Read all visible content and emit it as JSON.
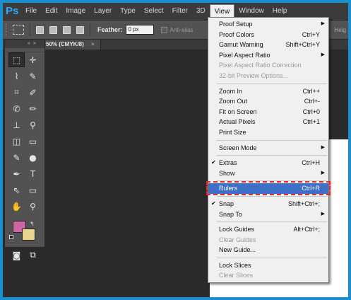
{
  "menubar": {
    "logo": "Ps",
    "items": [
      "File",
      "Edit",
      "Image",
      "Layer",
      "Type",
      "Select",
      "Filter",
      "3D",
      "View",
      "Window",
      "Help"
    ],
    "active": "View"
  },
  "options": {
    "feather_label": "Feather:",
    "feather_value": "0 px",
    "antialias_label": "Anti-alias",
    "height_label": "Heig"
  },
  "document": {
    "tab_label": "50% (CMYK/8)",
    "close_glyph": "×"
  },
  "tools_panel": {
    "header": "«  »",
    "tool_glyphs": [
      [
        "⬚",
        "✛"
      ],
      [
        "⌇",
        "✎"
      ],
      [
        "⌗",
        "✐"
      ],
      [
        "✆",
        "✏"
      ],
      [
        "⊥",
        "⚲"
      ],
      [
        "◫",
        "▭"
      ],
      [
        "✎",
        "●"
      ],
      [
        "✒",
        "T"
      ],
      [
        "⇖",
        "▭"
      ],
      [
        "✋",
        "⚲"
      ]
    ],
    "bottom_glyphs": [
      "◙",
      "⧉"
    ],
    "foreground_color": "#cc66a5",
    "background_color": "#ead58f"
  },
  "view_menu": {
    "items": [
      {
        "label": "Proof Setup",
        "shortcut": "",
        "submenu": true,
        "disabled": false
      },
      {
        "label": "Proof Colors",
        "shortcut": "Ctrl+Y",
        "submenu": false,
        "disabled": false
      },
      {
        "label": "Gamut Warning",
        "shortcut": "Shift+Ctrl+Y",
        "submenu": false,
        "disabled": false
      },
      {
        "label": "Pixel Aspect Ratio",
        "shortcut": "",
        "submenu": true,
        "disabled": false
      },
      {
        "label": "Pixel Aspect Ratio Correction",
        "shortcut": "",
        "submenu": false,
        "disabled": true
      },
      {
        "label": "32-bit Preview Options...",
        "shortcut": "",
        "submenu": false,
        "disabled": true
      },
      {
        "sep": true
      },
      {
        "label": "Zoom In",
        "shortcut": "Ctrl++",
        "submenu": false,
        "disabled": false
      },
      {
        "label": "Zoom Out",
        "shortcut": "Ctrl+-",
        "submenu": false,
        "disabled": false
      },
      {
        "label": "Fit on Screen",
        "shortcut": "Ctrl+0",
        "submenu": false,
        "disabled": false
      },
      {
        "label": "Actual Pixels",
        "shortcut": "Ctrl+1",
        "submenu": false,
        "disabled": false
      },
      {
        "label": "Print Size",
        "shortcut": "",
        "submenu": false,
        "disabled": false
      },
      {
        "sep": true
      },
      {
        "label": "Screen Mode",
        "shortcut": "",
        "submenu": true,
        "disabled": false
      },
      {
        "sep": true
      },
      {
        "label": "Extras",
        "shortcut": "Ctrl+H",
        "submenu": false,
        "disabled": false,
        "checked": true
      },
      {
        "label": "Show",
        "shortcut": "",
        "submenu": true,
        "disabled": false
      },
      {
        "sep": true
      },
      {
        "label": "Rulers",
        "shortcut": "Ctrl+R",
        "submenu": false,
        "disabled": false,
        "highlighted": true
      },
      {
        "sep": true
      },
      {
        "label": "Snap",
        "shortcut": "Shift+Ctrl+;",
        "submenu": false,
        "disabled": false,
        "checked": true
      },
      {
        "label": "Snap To",
        "shortcut": "",
        "submenu": true,
        "disabled": false
      },
      {
        "sep": true
      },
      {
        "label": "Lock Guides",
        "shortcut": "Alt+Ctrl+;",
        "submenu": false,
        "disabled": false
      },
      {
        "label": "Clear Guides",
        "shortcut": "",
        "submenu": false,
        "disabled": true
      },
      {
        "label": "New Guide...",
        "shortcut": "",
        "submenu": false,
        "disabled": false
      },
      {
        "sep": true
      },
      {
        "label": "Lock Slices",
        "shortcut": "",
        "submenu": false,
        "disabled": false
      },
      {
        "label": "Clear Slices",
        "shortcut": "",
        "submenu": false,
        "disabled": true
      }
    ],
    "check_glyph": "✔",
    "submenu_glyph": "▶"
  },
  "colors": {
    "highlight": "#3f70c8",
    "callout": "#e8292b",
    "frame_border": "#1a8fd0"
  }
}
